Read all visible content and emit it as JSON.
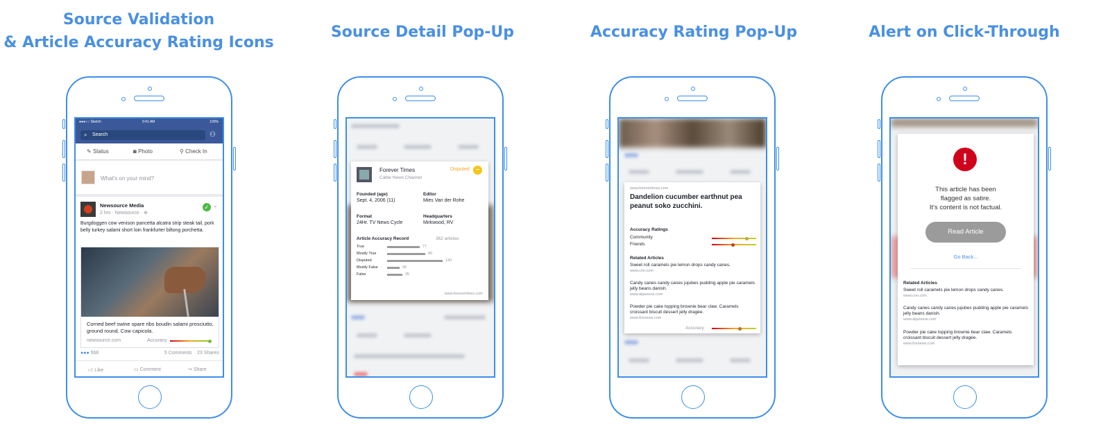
{
  "panels": [
    {
      "title_line1": "Source Validation",
      "title_line2": "& Article Accuracy Rating Icons"
    },
    {
      "title": "Source Detail Pop-Up"
    },
    {
      "title": "Accuracy Rating Pop-Up"
    },
    {
      "title": "Alert on Click-Through"
    }
  ],
  "feed": {
    "status_bar": {
      "carrier": "●●●○○ Sketch",
      "time": "9:41 AM",
      "battery": "100%"
    },
    "search_placeholder": "Search",
    "composer_tabs": [
      "Status",
      "Photo",
      "Check In"
    ],
    "composer_prompt": "What's on your mind?",
    "post": {
      "author": "Newsource Media",
      "meta": "2 hrs · Newsource · ⊕",
      "text": "Burgdoggen cow venison pancetta alcatra strip steak tail, pork belly turkey salami short loin frankfurter biltong porchetta.",
      "link_title": "Corned beef swine spare ribs boudin salami prosciutto, ground round. Cow capicola.",
      "link_domain": "newsource.com",
      "accuracy_label": "Accuracy",
      "reactions_count": "568",
      "comments": "5 Comments",
      "shares": "23 Shares",
      "actions": [
        "Like",
        "Comment",
        "Share"
      ]
    }
  },
  "source_popup": {
    "name": "Forever Times",
    "type": "Cable News Channel",
    "status": "Disputed",
    "founded_label": "Founded (age)",
    "founded_value": "Sept. 4, 2006 (11)",
    "editor_label": "Editor",
    "editor_value": "Mies Van der Rohe",
    "format_label": "Format",
    "format_value": "24Hr. TV News Cycle",
    "hq_label": "Headquarters",
    "hq_value": "Mirkwood, RV",
    "record_label": "Article Accuracy Record",
    "record_count": "362 articles",
    "record": [
      {
        "label": "True",
        "value": 77
      },
      {
        "label": "Mostly True",
        "value": 90
      },
      {
        "label": "Disputed",
        "value": 130
      },
      {
        "label": "Mostly False",
        "value": 30
      },
      {
        "label": "False",
        "value": 35
      }
    ],
    "url": "www.forevertimes.com"
  },
  "accuracy_popup": {
    "url": "www.forevertimes.com",
    "headline": "Dandelion cucumber earthnut pea peanut soko zucchini.",
    "ratings_label": "Accuracy Ratings",
    "rating_rows": [
      "Community",
      "Friends"
    ],
    "related_label": "Related Articles",
    "related": [
      {
        "title": "Sweet roll caramels pie lemon drops candy canes.",
        "source": "www.cnn.com"
      },
      {
        "title": "Candy canes candy canes jujubes pudding apple pie caramels jelly beans danish.",
        "source": "www.aljazeera.com"
      },
      {
        "title": "Powder pie cake topping brownie bear claw. Caramels croissant biscuit dessert jelly dragée.",
        "source": "www.foxnews.com"
      }
    ],
    "accuracy_label": "Accuracy"
  },
  "alert_popup": {
    "icon": "exclamation-icon",
    "message_line1": "This article has been",
    "message_line2": "flagged as satire.",
    "message_line3": "It's content is not factual.",
    "read_button": "Read Article",
    "back_link": "Go Back...",
    "related_label": "Related Articles",
    "related": [
      {
        "title": "Sweet roll caramels pie lemon drops candy canes.",
        "source": "www.cnn.com"
      },
      {
        "title": "Candy canes candy canes jujubes pudding apple pie caramels jelly beans danish.",
        "source": "www.aljazeera.com"
      },
      {
        "title": "Powder pie cake topping brownie bear claw. Caramels croissant biscuit dessert jelly dragée.",
        "source": "www.foxnews.com"
      }
    ]
  },
  "colors": {
    "accent": "#4a90e2",
    "facebook_blue": "#3b5998",
    "check_green": "#4cb944",
    "disputed": "#f5c518",
    "alert_red": "#d0021b"
  }
}
